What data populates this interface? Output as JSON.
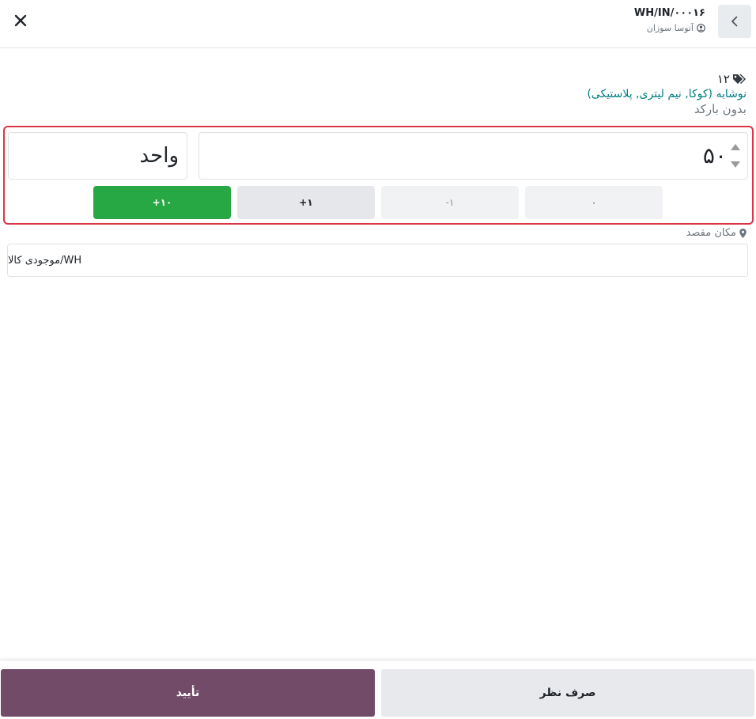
{
  "header": {
    "doc_ref": "WH/IN/۰۰۰۱۶",
    "responsible": "آتوسا سوزان"
  },
  "product": {
    "quantity": "۱۲",
    "name": "نوشابه (کوکا, نیم لیتری, پلاستیکی)",
    "barcode_status": "بدون بارکد"
  },
  "quantity_editor": {
    "value": "۵۰",
    "uom": "واحد",
    "buttons": {
      "zero": "۰",
      "minus_one": "-۱",
      "plus_one": "+۱",
      "plus_ten": "+۱۰"
    }
  },
  "destination": {
    "label": "مکان مقصد",
    "value": "WH/موجودی کالا"
  },
  "footer": {
    "confirm": "تأیید",
    "discard": "صرف نظر"
  },
  "colors": {
    "accent": "#714b67",
    "success": "#28a745",
    "highlight_border": "#dc3545",
    "product_link": "#017e84"
  },
  "icons": [
    "close-icon",
    "chevron-left-icon",
    "user-circle-icon",
    "tags-icon",
    "map-marker-icon"
  ]
}
